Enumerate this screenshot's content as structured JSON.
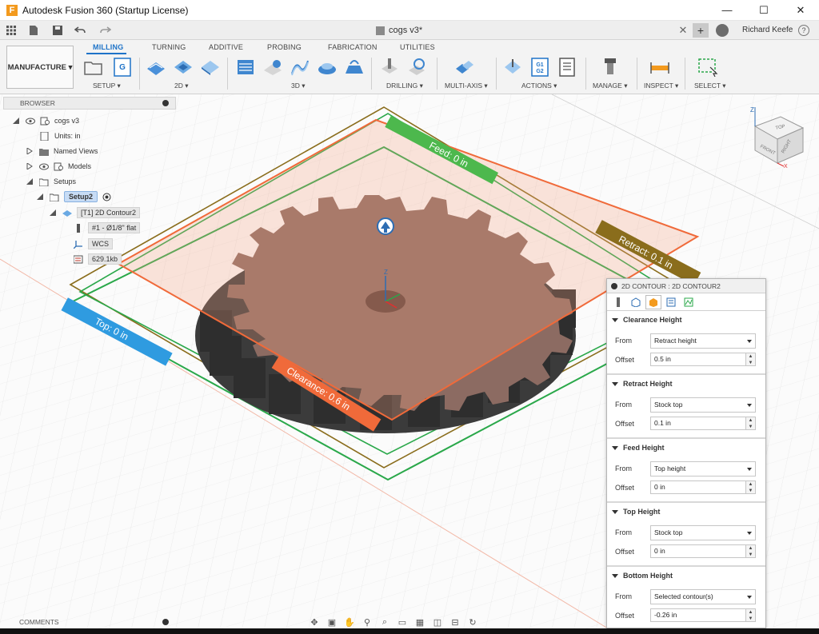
{
  "window": {
    "title": "Autodesk Fusion 360 (Startup License)",
    "minimize": "—",
    "maximize": "☐",
    "close": "✕"
  },
  "quickbar": {
    "document_tab": "cogs v3*",
    "tab_close": "✕",
    "tab_add": "+",
    "user": "Richard Keefe",
    "help": "?"
  },
  "ribbon": {
    "workspace": "MANUFACTURE ▾",
    "tabs": [
      "MILLING",
      "TURNING",
      "ADDITIVE",
      "PROBING",
      "FABRICATION",
      "UTILITIES"
    ],
    "groups": [
      "SETUP ▾",
      "2D ▾",
      "3D ▾",
      "DRILLING ▾",
      "MULTI-AXIS ▾",
      "ACTIONS ▾",
      "MANAGE ▾",
      "INSPECT ▾",
      "SELECT ▾"
    ]
  },
  "browser": {
    "header": "BROWSER",
    "items": [
      {
        "label": "cogs v3"
      },
      {
        "label": "Units: in"
      },
      {
        "label": "Named Views"
      },
      {
        "label": "Models"
      },
      {
        "label": "Setups"
      },
      {
        "label": "Setup2"
      },
      {
        "label": "[T1] 2D Contour2"
      },
      {
        "label": "#1 - Ø1/8\" flat"
      },
      {
        "label": "WCS"
      },
      {
        "label": "629.1kb"
      }
    ]
  },
  "viewport": {
    "labels": {
      "feed": "Feed: 0 in",
      "retract": "Retract: 0.1 in",
      "top": "Top: 0 in",
      "clearance": "Clearance: 0.6 in"
    },
    "colors": {
      "clearance": "#f06a3a",
      "retract": "#8a6d1c",
      "feed": "#4db84d",
      "top": "#2f9be0",
      "gear": "#8c6b62"
    },
    "viewcube": {
      "top": "TOP",
      "front": "FRONT",
      "right": "RIGHT",
      "z": "Z",
      "x": "X"
    }
  },
  "props": {
    "title": "2D CONTOUR : 2D CONTOUR2",
    "sections": [
      {
        "title": "Clearance Height",
        "from_label": "From",
        "from": "Retract height",
        "offset_label": "Offset",
        "offset": "0.5 in"
      },
      {
        "title": "Retract Height",
        "from_label": "From",
        "from": "Stock top",
        "offset_label": "Offset",
        "offset": "0.1 in"
      },
      {
        "title": "Feed Height",
        "from_label": "From",
        "from": "Top height",
        "offset_label": "Offset",
        "offset": "0 in"
      },
      {
        "title": "Top Height",
        "from_label": "From",
        "from": "Stock top",
        "offset_label": "Offset",
        "offset": "0 in"
      },
      {
        "title": "Bottom Height",
        "from_label": "From",
        "from": "Selected contour(s)",
        "offset_label": "Offset",
        "offset": "-0.26 in"
      }
    ]
  },
  "bottom": {
    "comments": "COMMENTS"
  }
}
